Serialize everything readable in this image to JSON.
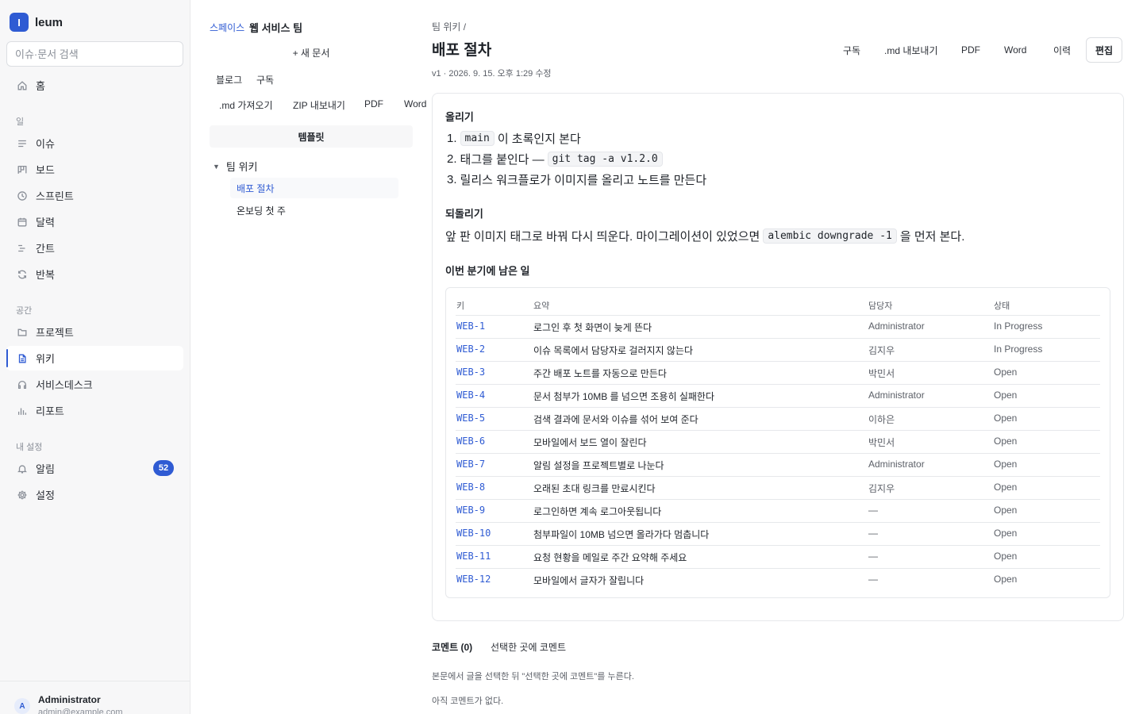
{
  "brand": {
    "logo_letter": "I",
    "name": "leum"
  },
  "search": {
    "placeholder": "이슈·문서 검색"
  },
  "nav": {
    "home": "홈",
    "sections": {
      "work": "일",
      "space": "공간",
      "my": "내 설정"
    },
    "work_items": [
      "이슈",
      "보드",
      "스프린트",
      "달력",
      "간트",
      "반복"
    ],
    "space_items": [
      "프로젝트",
      "위키",
      "서비스데스크",
      "리포트"
    ],
    "my_items": [
      "알림",
      "설정"
    ],
    "notification_count": "52",
    "active": "위키"
  },
  "user": {
    "initial": "A",
    "name": "Administrator",
    "email": "admin@example.com"
  },
  "tree": {
    "space_link": "스페이스",
    "team": "웹 서비스 팀",
    "new_doc": "+ 새 문서",
    "tabs": [
      "블로그",
      "구독"
    ],
    "tools": [
      ".md 가져오기",
      "ZIP 내보내기",
      "PDF",
      "Word"
    ],
    "template": "템플릿",
    "root": "팀 위키",
    "children": [
      "배포 절차",
      "온보딩 첫 주"
    ],
    "selected": "배포 절차"
  },
  "doc": {
    "breadcrumb": "팀 위키 /",
    "title": "배포 절차",
    "meta": "v1 · 2026. 9. 15. 오후 1:29 수정",
    "actions": [
      "구독",
      ".md 내보내기",
      "PDF",
      "Word",
      "이력",
      "편집"
    ],
    "section_up": "올리기",
    "steps": [
      {
        "num": "1.",
        "code": "main",
        "text": "이 초록인지 본다"
      },
      {
        "num": "2.",
        "text": "태그를 붙인다 —",
        "code": "git tag -a v1.2.0"
      },
      {
        "num": "3.",
        "text": "릴리스 워크플로가 이미지를 올리고 노트를 만든다"
      }
    ],
    "section_rollback": "되돌리기",
    "rollback": {
      "before": "앞 판 이미지 태그로 바꿔 다시 띄운다. 마이그레이션이 있었으면",
      "code": "alembic downgrade -1",
      "after": "을 먼저 본다."
    },
    "section_quarter": "이번 분기에 남은 일",
    "table": {
      "headers": [
        "키",
        "요약",
        "담당자",
        "상태"
      ],
      "rows": [
        [
          "WEB-1",
          "로그인 후 첫 화면이 늦게 뜬다",
          "Administrator",
          "In Progress"
        ],
        [
          "WEB-2",
          "이슈 목록에서 담당자로 걸러지지 않는다",
          "김지우",
          "In Progress"
        ],
        [
          "WEB-3",
          "주간 배포 노트를 자동으로 만든다",
          "박민서",
          "Open"
        ],
        [
          "WEB-4",
          "문서 첨부가 10MB 를 넘으면 조용히 실패한다",
          "Administrator",
          "Open"
        ],
        [
          "WEB-5",
          "검색 결과에 문서와 이슈를 섞어 보여 준다",
          "이하은",
          "Open"
        ],
        [
          "WEB-6",
          "모바일에서 보드 열이 잘린다",
          "박민서",
          "Open"
        ],
        [
          "WEB-7",
          "알림 설정을 프로젝트별로 나눈다",
          "Administrator",
          "Open"
        ],
        [
          "WEB-8",
          "오래된 초대 링크를 만료시킨다",
          "김지우",
          "Open"
        ],
        [
          "WEB-9",
          "로그인하면 계속 로그아웃됩니다",
          "—",
          "Open"
        ],
        [
          "WEB-10",
          "첨부파일이 10MB 넘으면 올라가다 멈춥니다",
          "—",
          "Open"
        ],
        [
          "WEB-11",
          "요청 현황을 메일로 주간 요약해 주세요",
          "—",
          "Open"
        ],
        [
          "WEB-12",
          "모바일에서 글자가 잘립니다",
          "—",
          "Open"
        ]
      ]
    }
  },
  "comments": {
    "heading": "코멘트 (0)",
    "selected_comment": "선택한 곳에 코멘트",
    "hint": "본문에서 글을 선택한 뒤 \"선택한 곳에 코멘트\"를 누른다.",
    "empty": "아직 코멘트가 없다."
  },
  "colors": {
    "accent": "#2f5bd3",
    "sidebar_bg": "#f7f7f8",
    "border": "#e6e8eb"
  }
}
